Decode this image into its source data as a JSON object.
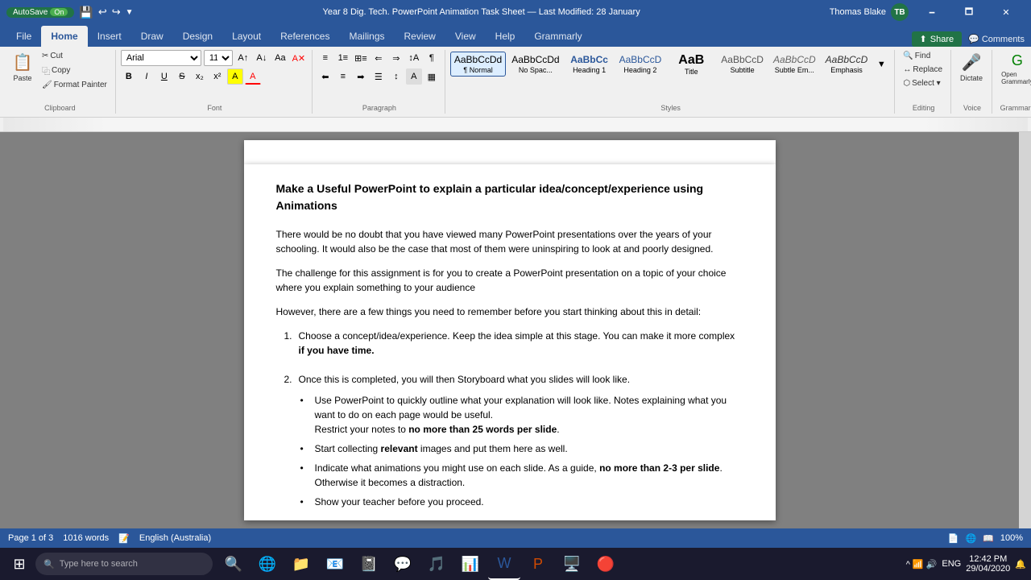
{
  "titleBar": {
    "autosave": "AutoSave",
    "autosave_state": "On",
    "title": "Year 8 Dig. Tech. PowerPoint Animation Task Sheet — Last Modified: 28 January",
    "user": "Thomas Blake",
    "user_initials": "TB",
    "minimize": "🗕",
    "maximize": "🗖",
    "close": "✕"
  },
  "ribbonTabs": {
    "tabs": [
      "File",
      "Home",
      "Insert",
      "Draw",
      "Design",
      "Layout",
      "References",
      "Mailings",
      "Review",
      "View",
      "Help",
      "Grammarly"
    ],
    "active": "Home",
    "share": "Share",
    "comments": "Comments"
  },
  "ribbon": {
    "clipboard": {
      "label": "Clipboard",
      "paste": "Paste",
      "cut": "Cut",
      "copy": "Copy",
      "format_painter": "Format Painter"
    },
    "font": {
      "label": "Font",
      "font_name": "Arial",
      "font_size": "11",
      "bold": "B",
      "italic": "I",
      "underline": "U",
      "strikethrough": "S",
      "subscript": "x₂",
      "superscript": "x²"
    },
    "paragraph": {
      "label": "Paragraph"
    },
    "styles": {
      "label": "Styles",
      "items": [
        {
          "name": "Normal",
          "preview": "AaBbCcDd",
          "subtitle": "¶ Normal"
        },
        {
          "name": "No Spacing",
          "preview": "AaBbCcDd",
          "subtitle": "No Spac..."
        },
        {
          "name": "Heading 1",
          "preview": "AaBbCc",
          "subtitle": "Heading 1"
        },
        {
          "name": "Heading 2",
          "preview": "AaBbCcD",
          "subtitle": "Heading 2"
        },
        {
          "name": "Title",
          "preview": "AaB",
          "subtitle": "Title"
        },
        {
          "name": "Subtitle",
          "preview": "AaBbCcD",
          "subtitle": "Subtitle"
        },
        {
          "name": "Subtle Emphasis",
          "preview": "AaBbCcD",
          "subtitle": "Subtle Em..."
        },
        {
          "name": "Emphasis",
          "preview": "AaBbCcD",
          "subtitle": "Emphasis"
        }
      ]
    },
    "editing": {
      "label": "Editing",
      "find": "Find",
      "replace": "Replace",
      "select": "Select ▾"
    },
    "voice": {
      "label": "Voice",
      "dictate": "Dictate"
    },
    "grammarly": {
      "label": "Grammarly",
      "open": "Open Grammarly"
    }
  },
  "document": {
    "heading": "Make a Useful PowerPoint to explain a particular idea/concept/experience using Animations",
    "para1": "There would be no doubt that you have viewed many PowerPoint presentations over the years of your schooling. It would also be the case that most of them were uninspiring to look at and poorly designed.",
    "para2": "The challenge for this assignment is for you to create a PowerPoint presentation on a topic of your choice where you explain something to your audience",
    "para3": "However, there are a few things you need to remember before you start thinking about this in detail:",
    "list_items": [
      {
        "num": "1.",
        "text_before": "Choose a concept/idea/experience.  Keep the idea simple at this stage. You can make it more complex ",
        "text_bold": "if you have time.",
        "text_after": ""
      },
      {
        "num": "2.",
        "text_before": "Once this is completed, you will then Storyboard what you slides will look like.",
        "text_bold": "",
        "text_after": ""
      }
    ],
    "bullets": [
      {
        "text_before": "Use PowerPoint to quickly outline what your explanation will look like. Notes explaining what you want to do on each page would be useful.\nRestrict your notes to ",
        "text_bold": "no more than 25 words per slide",
        "text_after": "."
      },
      {
        "text_before": "Start collecting ",
        "text_bold": "relevant",
        "text_after": " images and put them here as well."
      },
      {
        "text_before": "Indicate what animations you might use on each slide. As a guide, ",
        "text_bold": "no more than 2-3 per slide",
        "text_after": ". Otherwise it becomes a distraction."
      },
      {
        "text_before": "Show your teacher before you proceed.",
        "text_bold": "",
        "text_after": ""
      }
    ]
  },
  "statusBar": {
    "page_info": "Page 1 of 3",
    "word_count": "1016 words",
    "language": "English (Australia)",
    "zoom": "100%"
  },
  "taskbar": {
    "search_placeholder": "Type here to search",
    "time": "12:42 PM",
    "date": "29/04/2020",
    "apps": [
      "⊞",
      "🔍",
      "🌐",
      "📁",
      "📧",
      "📓",
      "💬",
      "🎵",
      "📊",
      "📝",
      "🖥️",
      "🔴"
    ],
    "system_tray": "ENG"
  }
}
